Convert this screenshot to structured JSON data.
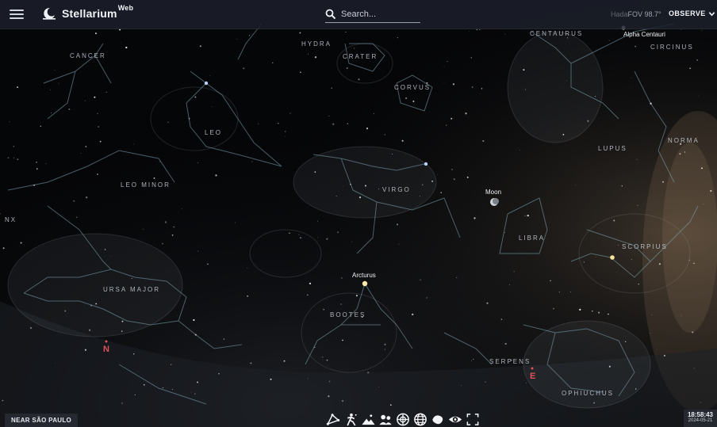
{
  "app": {
    "name": "Stellarium",
    "name_suffix": "Web"
  },
  "header": {
    "search_placeholder": "Search...",
    "fov_readout": "FOV 98.7°",
    "observe_label": "OBSERVE",
    "hidden_label": "Hada"
  },
  "sky": {
    "constellations": [
      {
        "name": "CANCER"
      },
      {
        "name": "HYDRA"
      },
      {
        "name": "CRATER"
      },
      {
        "name": "CORVUS"
      },
      {
        "name": "CENTAURUS"
      },
      {
        "name": "CIRCINUS"
      },
      {
        "name": "LEO"
      },
      {
        "name": "LUPUS"
      },
      {
        "name": "NORMA"
      },
      {
        "name": "LEO MINOR"
      },
      {
        "name": "VIRGO"
      },
      {
        "name": "NX"
      },
      {
        "name": "LIBRA"
      },
      {
        "name": "SCORPIUS"
      },
      {
        "name": "URSA MAJOR"
      },
      {
        "name": "BOOTES"
      },
      {
        "name": "SERPENS"
      },
      {
        "name": "OPHIUCHUS"
      }
    ],
    "objects": [
      {
        "name": "Alpha Centauri"
      },
      {
        "name": "Moon"
      },
      {
        "name": "Arcturus"
      }
    ],
    "cardinals": [
      {
        "name": "N"
      },
      {
        "name": "E"
      }
    ]
  },
  "footer": {
    "location": "NEAR SÃO PAULO",
    "time": "18:58:43",
    "date": "2024-05-21",
    "tools": [
      "constellation-lines-icon",
      "constellation-art-icon",
      "landscape-icon",
      "atmosphere-icon",
      "azimuthal-grid-icon",
      "equatorial-grid-icon",
      "nebulae-icon",
      "night-mode-icon",
      "fullscreen-icon"
    ]
  }
}
